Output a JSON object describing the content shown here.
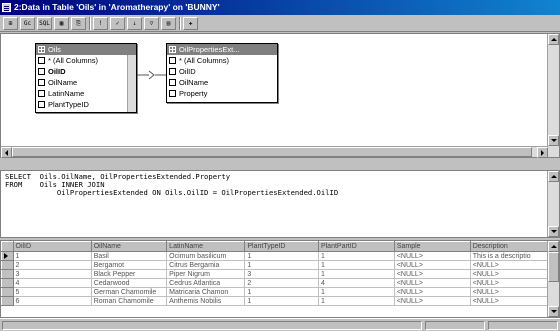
{
  "window": {
    "title": "2:Data in Table 'Oils' in 'Aromatherapy' on 'BUNNY'"
  },
  "toolbar": {
    "buttons": [
      {
        "icon": "diagram-pane-icon",
        "glyph": "⊞"
      },
      {
        "icon": "grid-pane-icon",
        "glyph": "Gc"
      },
      {
        "icon": "sql-pane-icon",
        "glyph": "SQL"
      },
      {
        "icon": "results-pane-icon",
        "glyph": "▦"
      },
      {
        "icon": "change-query-type-icon",
        "glyph": "⎘"
      },
      {
        "icon": "run-icon",
        "glyph": "!"
      },
      {
        "icon": "verify-sql-icon",
        "glyph": "✓"
      },
      {
        "icon": "sort-icon",
        "glyph": "↓"
      },
      {
        "icon": "filter-icon",
        "glyph": "▽"
      },
      {
        "icon": "group-by-icon",
        "glyph": "▤"
      },
      {
        "icon": "add-table-icon",
        "glyph": "✚"
      }
    ]
  },
  "diagram": {
    "tables": [
      {
        "title": "Oils",
        "rows": [
          {
            "label": "* (All Columns)",
            "key": false
          },
          {
            "label": "OilID",
            "key": true
          },
          {
            "label": "OilName",
            "key": false
          },
          {
            "label": "LatinName",
            "key": false
          },
          {
            "label": "PlantTypeID",
            "key": false
          }
        ]
      },
      {
        "title": "OilPropertiesExt...",
        "rows": [
          {
            "label": "* (All Columns)",
            "key": false
          },
          {
            "label": "OilID",
            "key": false
          },
          {
            "label": "OilName",
            "key": false
          },
          {
            "label": "Property",
            "key": false
          }
        ]
      }
    ]
  },
  "sql": {
    "lines": [
      "SELECT  Oils.OilName, OilPropertiesExtended.Property",
      "FROM    Oils INNER JOIN",
      "            OilPropertiesExtended ON Oils.OilID = OilPropertiesExtended.OilID"
    ]
  },
  "results": {
    "columns": [
      "OilID",
      "OilName",
      "LatinName",
      "PlantTypeID",
      "PlantPartID",
      "Sample",
      "Description"
    ],
    "rows": [
      [
        "1",
        "Basil",
        "Ocimum basilicum",
        "1",
        "1",
        "<NULL>",
        "This is a descriptio"
      ],
      [
        "2",
        "Bergamot",
        "Citrus Bergamia",
        "1",
        "1",
        "<NULL>",
        "<NULL>"
      ],
      [
        "3",
        "Black Pepper",
        "Piper Nigrum",
        "3",
        "1",
        "<NULL>",
        "<NULL>"
      ],
      [
        "4",
        "Cedarwood",
        "Cedrus Atlantica",
        "2",
        "4",
        "<NULL>",
        "<NULL>"
      ],
      [
        "5",
        "German Chamomile",
        "Matricaria Chamon",
        "1",
        "1",
        "<NULL>",
        "<NULL>"
      ],
      [
        "6",
        "Roman Chamomile",
        "Anthemis Nobilis",
        "1",
        "1",
        "<NULL>",
        "<NULL>"
      ]
    ],
    "current_row": 0
  }
}
